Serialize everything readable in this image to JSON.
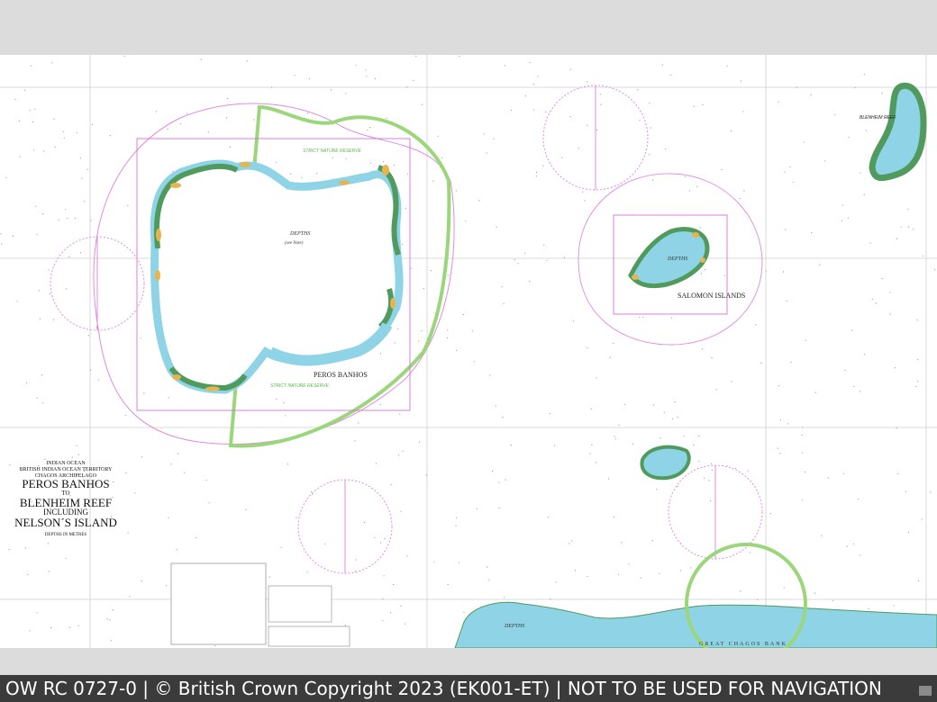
{
  "chart": {
    "islands": {
      "peros_banhos": "PEROS BANHOS",
      "salomon": "SALOMON ISLANDS",
      "blenheim": "BLENHEIM REEF",
      "great_chagos": "GREAT CHAGOS BANK"
    },
    "labels": {
      "depths": "DEPTHS",
      "see_note": "(see Note)",
      "reserve": "STRICT NATURE RESERVE"
    },
    "title_block": {
      "line1": "INDIAN OCEAN",
      "line2": "BRITISH INDIAN OCEAN TERRITORY",
      "line3": "CHAGOS ARCHIPELAGO",
      "name1": "PEROS BANHOS",
      "to": "TO",
      "name2": "BLENHEIM REEF",
      "including": "INCLUDING",
      "name3": "NELSON´S ISLAND",
      "depth_units": "DEPTHS IN METRES"
    },
    "colors": {
      "land": "#e8b44c",
      "drying": "#4f9a5c",
      "shallow": "#8fd3e6",
      "reserve": "#9bd67a",
      "limit": "#d96fd9",
      "grid": "#c8c8c8"
    }
  },
  "footer": {
    "text": "OW RC 0727-0 | © British Crown Copyright 2023 (EK001-ET) | NOT TO BE USED FOR NAVIGATION"
  }
}
